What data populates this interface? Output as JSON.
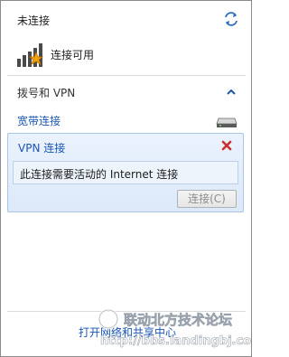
{
  "header": {
    "status_title": "未连接",
    "refresh_icon": "refresh-arrows-icon",
    "available_label": "连接可用",
    "signal_icon": "wireless-signal-star-icon"
  },
  "dialup_section": {
    "label": "拨号和 VPN",
    "collapse_icon": "chevron-up-icon",
    "items": [
      {
        "label": "宽带连接",
        "icon": "modem-icon"
      }
    ]
  },
  "vpn": {
    "title": "VPN 连接",
    "close_icon": "red-x-icon",
    "message": "此连接需要活动的 Internet 连接",
    "connect_button": "连接(C)"
  },
  "footer": {
    "open_center_link": "打开网络和共享中心"
  },
  "watermark": {
    "text": "联动北方技术论坛",
    "url": "http://bbs.landingbj.com"
  },
  "colors": {
    "link": "#1a56b3",
    "vpn_bg": "#dce9f9",
    "vpn_border": "#a9c5e8",
    "close_red": "#c9302c",
    "signal_green": "#3a3a3a",
    "star_orange": "#f2a20c"
  }
}
